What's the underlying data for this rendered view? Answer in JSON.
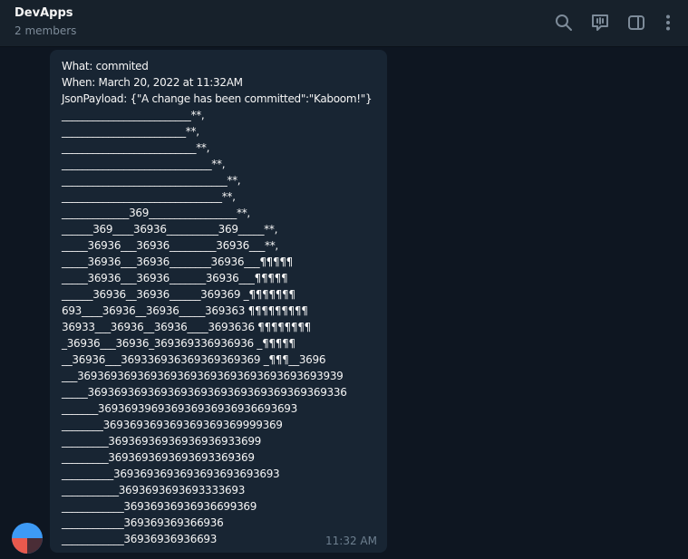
{
  "header": {
    "title": "DevApps",
    "subtitle": "2 members",
    "icons": [
      "search-icon",
      "live-chat-icon",
      "sidebar-toggle-icon",
      "more-icon"
    ]
  },
  "message": {
    "lines": [
      "What: commited",
      "When: March 20, 2022 at 11:32AM",
      "JsonPayload: {\"A change has been committed\":\"Kaboom!\"}",
      "_________________________**,",
      "________________________**,",
      "__________________________**,",
      "_____________________________**,",
      "________________________________**,",
      "_______________________________**,",
      "_____________369_________________**,",
      "______369____36936__________369_____**,",
      "_____36936___36936_________36936___**,",
      "_____36936___36936________36936___¶¶¶¶¶",
      "_____36936___36936_______36936___¶¶¶¶¶",
      "______36936__36936______369369 _¶¶¶¶¶¶¶",
      "693____36936__36936_____369363 ¶¶¶¶¶¶¶¶¶",
      "36933___36936__36936____3693636 ¶¶¶¶¶¶¶¶",
      "_36936___36936_369369336936936 _¶¶¶¶¶",
      "__36936___369336936369369369369 _¶¶¶__3696",
      "___3693693693693693693693693693693693693939",
      "_____369369369369369369369369369369369369336",
      "_______369369396936936936936936693693",
      "________369369369369369369369999369",
      "_________36936936936936936933699",
      "_________3693693693693693369369",
      "__________3693693693693693693693693",
      "___________3693693693693333693",
      "____________36936936936936699369",
      "____________369369369366936",
      "____________36936936936693"
    ],
    "time": "11:32 AM"
  },
  "colors": {
    "header_bg": "#17212b",
    "chat_bg": "#0e1621",
    "bubble_bg": "#182533",
    "text": "#f5f5f5",
    "muted": "#7d8b99",
    "avatar_blue": "#3d9af5",
    "avatar_red": "#e8594d"
  }
}
